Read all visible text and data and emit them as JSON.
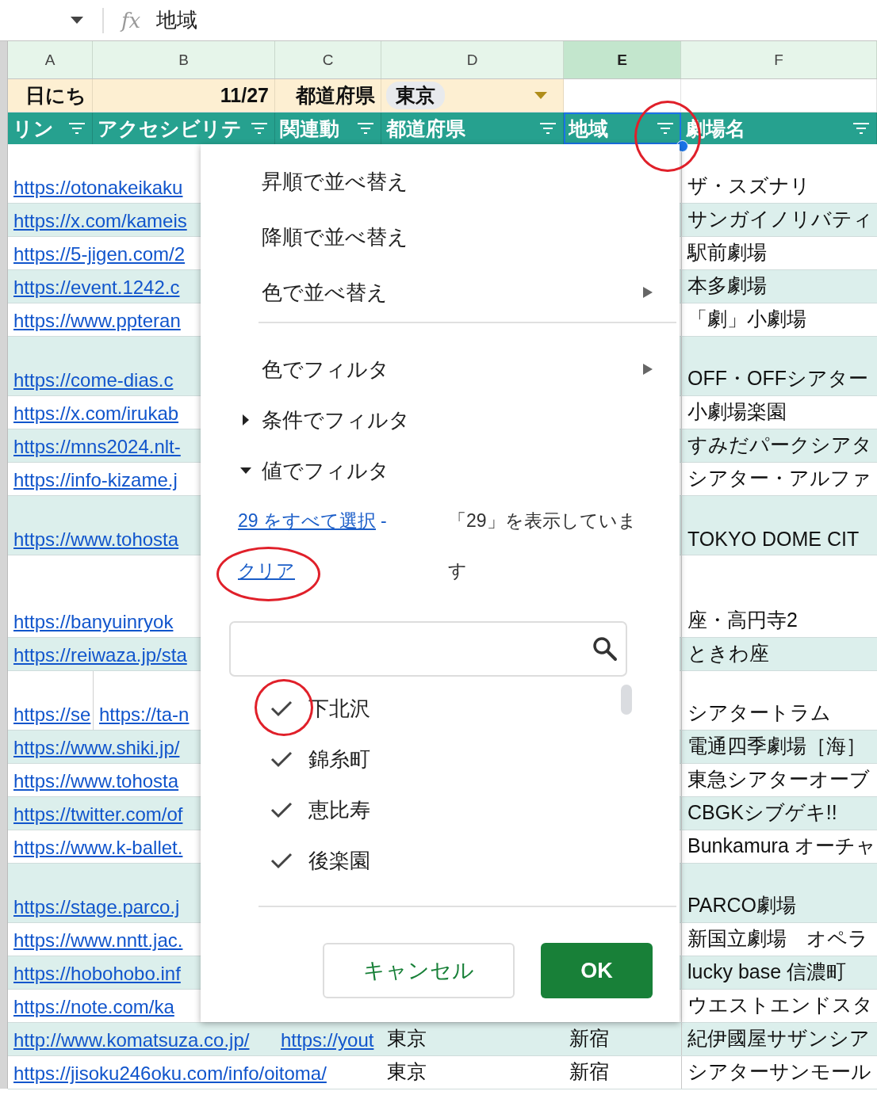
{
  "formula_bar": {
    "fx": "fx",
    "value": "地域"
  },
  "columns": [
    {
      "label": "A",
      "selected": false
    },
    {
      "label": "B",
      "selected": false
    },
    {
      "label": "C",
      "selected": false
    },
    {
      "label": "D",
      "selected": false
    },
    {
      "label": "E",
      "selected": true
    },
    {
      "label": "F",
      "selected": false
    }
  ],
  "row_1": [
    {
      "kind": "label",
      "text": "日にち"
    },
    {
      "kind": "value",
      "text": "11/27"
    },
    {
      "kind": "label",
      "text": "都道府県"
    },
    {
      "kind": "chip",
      "text": "東京"
    }
  ],
  "header_row": [
    {
      "label": "リン",
      "selected": false
    },
    {
      "label": "アクセシビリテ",
      "selected": false
    },
    {
      "label": "関連動",
      "selected": false
    },
    {
      "label": "都道府県",
      "selected": false
    },
    {
      "label": "地域",
      "selected": true
    },
    {
      "label": "劇場名",
      "selected": false
    }
  ],
  "rows": [
    {
      "kind": "tall",
      "a": "https://otonakeikaku",
      "f": "ザ・スズナリ"
    },
    {
      "kind": "normal",
      "a": "https://x.com/kameis",
      "f": "サンガイノリバティ"
    },
    {
      "kind": "normal",
      "a": "https://5-jigen.com/2",
      "f": "駅前劇場"
    },
    {
      "kind": "normal",
      "a": "https://event.1242.c",
      "f": "本多劇場"
    },
    {
      "kind": "normal",
      "a": "https://www.ppteran",
      "f": "「劇」小劇場"
    },
    {
      "kind": "tall",
      "a": "https://come-dias.c",
      "f": "OFF・OFFシアター"
    },
    {
      "kind": "normal",
      "a": "https://x.com/irukab",
      "f": "小劇場楽園"
    },
    {
      "kind": "normal",
      "a": "https://mns2024.nlt-",
      "f": "すみだパークシアタ"
    },
    {
      "kind": "normal",
      "a": "https://info-kizame.j",
      "f": "シアター・アルファ"
    },
    {
      "kind": "tall",
      "a": "https://www.tohosta",
      "f": "TOKYO DOME CIT"
    },
    {
      "kind": "extra_tall",
      "a": "https://banyuinryok",
      "f": "座・高円寺2"
    },
    {
      "kind": "normal",
      "a": "https://reiwaza.jp/sta",
      "f": "ときわ座"
    },
    {
      "kind": "tall",
      "a": "https://se",
      "b": "https://ta-n",
      "f": "シアタートラム"
    },
    {
      "kind": "normal",
      "a": "https://www.shiki.jp/",
      "f": "電通四季劇場［海］"
    },
    {
      "kind": "normal",
      "a": "https://www.tohosta",
      "f": "東急シアターオーブ"
    },
    {
      "kind": "normal",
      "a": "https://twitter.com/of",
      "f": "CBGKシブゲキ!!"
    },
    {
      "kind": "normal",
      "a": "https://www.k-ballet.",
      "f": "Bunkamura オーチャ"
    },
    {
      "kind": "tall",
      "a": "https://stage.parco.j",
      "f": "PARCO劇場"
    },
    {
      "kind": "normal",
      "a": "https://www.nntt.jac.",
      "f": "新国立劇場　オペラ"
    },
    {
      "kind": "normal",
      "a": "https://hobohobo.inf",
      "f": "lucky base 信濃町"
    },
    {
      "kind": "normal",
      "a": "https://note.com/ka",
      "f": "ウエストエンドスタ"
    },
    {
      "kind": "normal",
      "a": "http://www.komatsuza.co.jp/",
      "c": "https://yout",
      "d": "東京",
      "e": "新宿",
      "f": "紀伊國屋サザンシア"
    },
    {
      "kind": "normal",
      "a": "https://jisoku246oku.com/info/oitoma/",
      "d": "東京",
      "e": "新宿",
      "f": "シアターサンモール"
    }
  ],
  "filter_menu": {
    "items": [
      {
        "kind": "action",
        "label": "昇順で並べ替え"
      },
      {
        "kind": "action",
        "label": "降順で並べ替え"
      },
      {
        "kind": "submenu",
        "label": "色で並べ替え"
      },
      {
        "kind": "divider"
      },
      {
        "kind": "submenu",
        "label": "色でフィルタ"
      },
      {
        "kind": "section",
        "label": "条件でフィルタ",
        "expanded": false
      },
      {
        "kind": "section",
        "label": "値でフィルタ",
        "expanded": true
      }
    ],
    "select_all_link": "29 をすべて選択",
    "separator": "-",
    "clear_link": "クリア",
    "status": "「29」を表示しています",
    "values": [
      {
        "label": "下北沢",
        "checked": true
      },
      {
        "label": "錦糸町",
        "checked": true
      },
      {
        "label": "恵比寿",
        "checked": true
      },
      {
        "label": "後楽園",
        "checked": true
      }
    ],
    "buttons": [
      {
        "kind": "secondary",
        "label": "キャンセル"
      },
      {
        "kind": "primary",
        "label": "OK"
      }
    ]
  }
}
